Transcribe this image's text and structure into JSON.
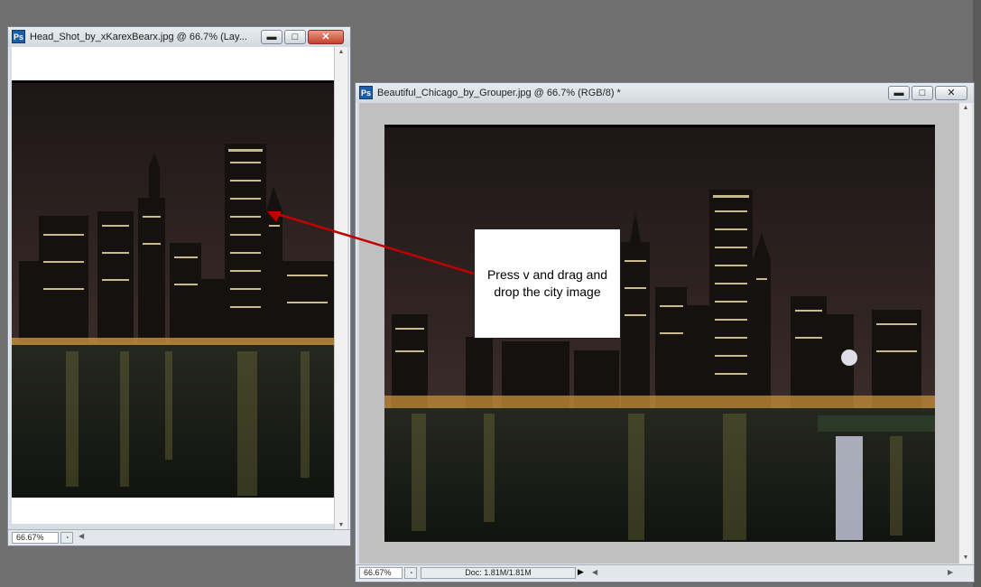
{
  "windows": [
    {
      "title": "Head_Shot_by_xKarexBearx.jpg @ 66.7% (Lay...",
      "zoom": "66.67%",
      "app_icon": "Ps"
    },
    {
      "title": "Beautiful_Chicago_by_Grouper.jpg @ 66.7% (RGB/8) *",
      "zoom": "66.67%",
      "doc_info": "Doc: 1.81M/1.81M",
      "app_icon": "Ps"
    }
  ],
  "callout": {
    "text": "Press v and drag and drop the city image"
  },
  "colors": {
    "arrow": "#c00000",
    "sky": "#2a2020",
    "water": "#1c1f18"
  },
  "icons": [
    "minimize-icon",
    "maximize-icon",
    "close-icon",
    "scroll-up-arrow",
    "scroll-down-arrow",
    "ps-app-icon"
  ]
}
